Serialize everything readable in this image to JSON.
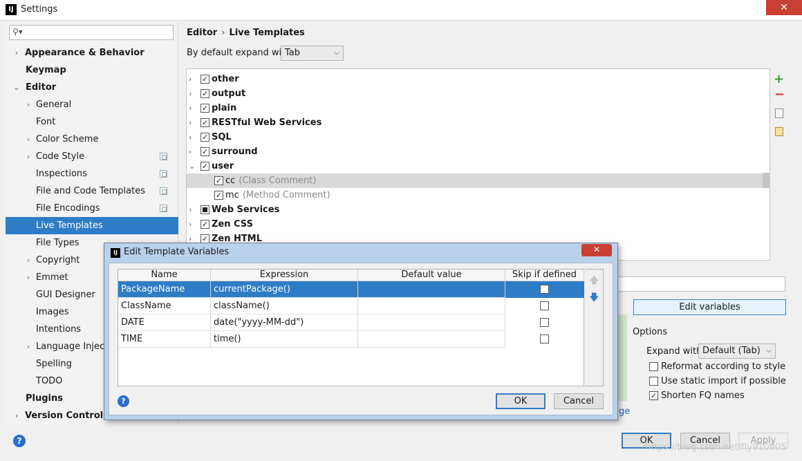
{
  "window": {
    "title": "Settings",
    "logo": "IJ"
  },
  "search": {
    "placeholder": ""
  },
  "sidebar": {
    "items": [
      {
        "label": "Appearance & Behavior",
        "expander": "›"
      },
      {
        "label": "Keymap"
      },
      {
        "label": "Editor",
        "expander": "⌄"
      },
      {
        "label": "General",
        "expander": "›"
      },
      {
        "label": "Font"
      },
      {
        "label": "Color Scheme",
        "expander": "›"
      },
      {
        "label": "Code Style",
        "expander": "›"
      },
      {
        "label": "Inspections"
      },
      {
        "label": "File and Code Templates"
      },
      {
        "label": "File Encodings"
      },
      {
        "label": "Live Templates"
      },
      {
        "label": "File Types"
      },
      {
        "label": "Copyright",
        "expander": "›"
      },
      {
        "label": "Emmet",
        "expander": "›"
      },
      {
        "label": "GUI Designer"
      },
      {
        "label": "Images"
      },
      {
        "label": "Intentions"
      },
      {
        "label": "Language Injections",
        "expander": "›"
      },
      {
        "label": "Spelling"
      },
      {
        "label": "TODO"
      },
      {
        "label": "Plugins"
      },
      {
        "label": "Version Control",
        "expander": "›"
      }
    ]
  },
  "breadcrumb": {
    "part1": "Editor",
    "sep": "›",
    "part2": "Live Templates"
  },
  "expand": {
    "label": "By default expand with",
    "value": "Tab",
    "dd": "⌵"
  },
  "templates": {
    "groups": [
      {
        "name": "other",
        "arrow": "›",
        "check": "✓"
      },
      {
        "name": "output",
        "arrow": "›",
        "check": "✓"
      },
      {
        "name": "plain",
        "arrow": "›",
        "check": "✓"
      },
      {
        "name": "RESTful Web Services",
        "arrow": "›",
        "check": "✓"
      },
      {
        "name": "SQL",
        "arrow": "›",
        "check": "✓"
      },
      {
        "name": "surround",
        "arrow": "›",
        "check": "✓"
      },
      {
        "name": "user",
        "arrow": "⌄",
        "check": "✓"
      },
      {
        "name": "cc",
        "desc": "(Class Comment)",
        "check": "✓"
      },
      {
        "name": "mc",
        "desc": "(Method Comment)",
        "check": "✓"
      },
      {
        "name": "Web Services",
        "arrow": "›",
        "check": ""
      },
      {
        "name": "Zen CSS",
        "arrow": "›",
        "check": "✓"
      },
      {
        "name": "Zen HTML",
        "arrow": "›",
        "check": "✓"
      }
    ]
  },
  "side_tools": {
    "add": "+",
    "remove": "−"
  },
  "options": {
    "edit_variables": "Edit variables",
    "title": "Options",
    "expand_with_label": "Expand with",
    "expand_with_value": "Default (Tab)",
    "reformat": "Reformat according to style",
    "static_import": "Use static import if possible",
    "shorten_fq": "Shorten FQ names",
    "check": "✓",
    "change_link": "ge"
  },
  "buttons": {
    "ok": "OK",
    "cancel": "Cancel",
    "apply": "Apply",
    "help": "?"
  },
  "watermark": "https://blog.csdn.net/fly910905",
  "dialog": {
    "title": "Edit Template Variables",
    "close": "✕",
    "columns": [
      "Name",
      "Expression",
      "Default value",
      "Skip if defined"
    ],
    "rows": [
      {
        "name": "PackageName",
        "expression": "currentPackage()",
        "default": ""
      },
      {
        "name": "ClassName",
        "expression": "className()",
        "default": ""
      },
      {
        "name": "DATE",
        "expression": "date(\"yyyy-MM-dd\")",
        "default": ""
      },
      {
        "name": "TIME",
        "expression": "time()",
        "default": ""
      }
    ],
    "up": "🡅",
    "down": "🡇",
    "ok": "OK",
    "cancel": "Cancel",
    "help": "?"
  }
}
